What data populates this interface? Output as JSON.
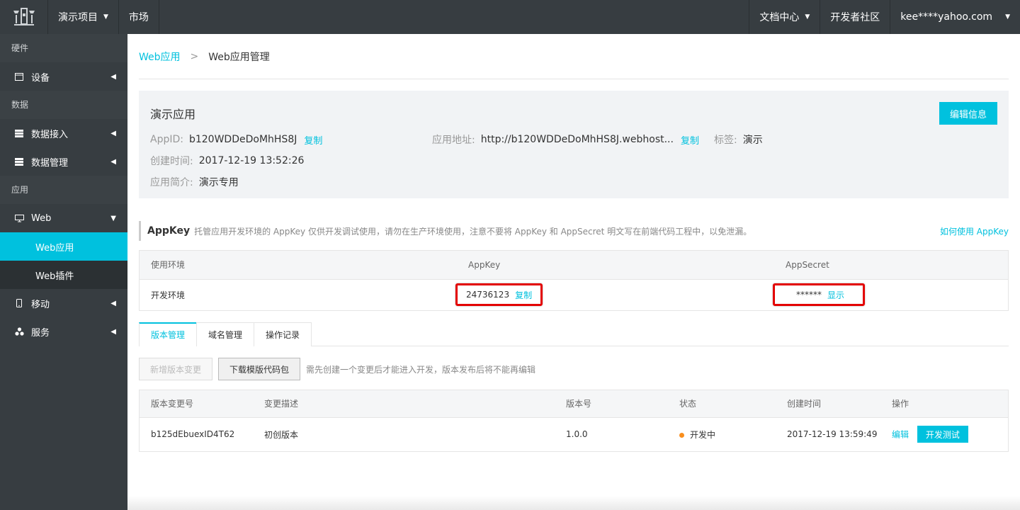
{
  "topbar": {
    "project": "演示项目",
    "market": "市场",
    "docs": "文档中心",
    "community": "开发者社区",
    "account": "kee****yahoo.com"
  },
  "sidebar": {
    "group_hardware": "硬件",
    "device": "设备",
    "group_data": "数据",
    "data_access": "数据接入",
    "data_manage": "数据管理",
    "group_app": "应用",
    "web": "Web",
    "web_app": "Web应用",
    "web_plugin": "Web插件",
    "mobile": "移动",
    "service": "服务"
  },
  "breadcrumb": {
    "parent": "Web应用",
    "separator": ">",
    "current": "Web应用管理"
  },
  "app": {
    "name": "演示应用",
    "edit_label": "编辑信息",
    "appid_label": "AppID:",
    "appid": "b120WDDeDoMhHS8J",
    "copy": "复制",
    "url_label": "应用地址:",
    "url": "http://b120WDDeDoMhHS8J.webhost...",
    "tag_label": "标签:",
    "tag": "演示",
    "created_label": "创建时间:",
    "created": "2017-12-19 13:52:26",
    "desc_label": "应用简介:",
    "desc": "演示专用"
  },
  "appkey": {
    "title": "AppKey",
    "hint": "托管应用开发环境的 AppKey 仅供开发调试使用，请勿在生产环境使用，注意不要将 AppKey 和 AppSecret 明文写在前端代码工程中，以免泄漏。",
    "howto": "如何使用 AppKey",
    "columns": [
      "使用环境",
      "AppKey",
      "AppSecret"
    ],
    "env": "开发环境",
    "key": "24736123",
    "copy": "复制",
    "secret": "******",
    "show": "显示"
  },
  "tabs": [
    "版本管理",
    "域名管理",
    "操作记录"
  ],
  "versions": {
    "new_btn": "新增版本变更",
    "download_btn": "下载模版代码包",
    "hint": "需先创建一个变更后才能进入开发，版本发布后将不能再编辑",
    "columns": [
      "版本变更号",
      "变更描述",
      "版本号",
      "状态",
      "创建时间",
      "操作"
    ],
    "row": {
      "id": "b125dEbuexID4T62",
      "desc": "初创版本",
      "version": "1.0.0",
      "status": "开发中",
      "created": "2017-12-19 13:59:49",
      "edit": "编辑",
      "test": "开发测试"
    }
  },
  "colors": {
    "accent": "#00c1de",
    "nav_bg": "#373d41",
    "status_dev": "#f98e1d",
    "highlight": "#e30000"
  }
}
